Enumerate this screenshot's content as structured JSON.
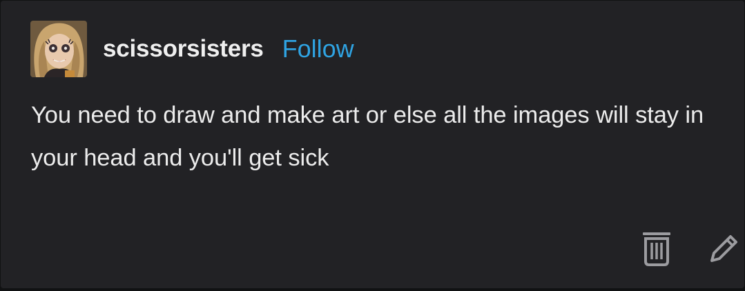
{
  "post": {
    "author": {
      "username": "scissorsisters",
      "follow_label": "Follow"
    },
    "body_text": "You need to draw and make art or else all the images will stay in your head and you'll get sick",
    "actions": {
      "delete_icon": "trash-icon",
      "edit_icon": "pencil-icon"
    }
  },
  "colors": {
    "background": "#222225",
    "text": "#ececec",
    "link": "#2fa3e2",
    "icon": "#9c9ca0"
  }
}
